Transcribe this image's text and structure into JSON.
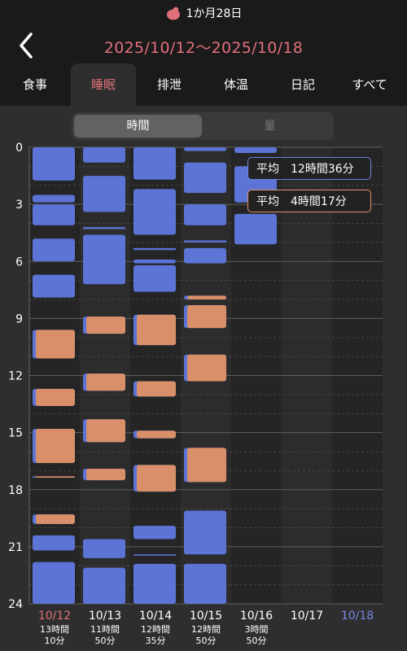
{
  "header": {
    "age": "1か月28日",
    "date_range": "2025/10/12〜2025/10/18"
  },
  "tabs": [
    {
      "label": "食事",
      "active": false
    },
    {
      "label": "睡眠",
      "active": true
    },
    {
      "label": "排泄",
      "active": false
    },
    {
      "label": "体温",
      "active": false
    },
    {
      "label": "日記",
      "active": false
    },
    {
      "label": "すべて",
      "active": false
    }
  ],
  "segment": {
    "selected": "時間",
    "other": "量"
  },
  "averages": [
    {
      "label": "平均",
      "value": "12時間36分"
    },
    {
      "label": "平均",
      "value": "4時間17分"
    }
  ],
  "colors": {
    "sleep": "#5b74d6",
    "sleep_edge": "#6b84e6",
    "overlap": "#d9906a",
    "accent": "#e0707a",
    "saturday": "#7b86e6",
    "panel": "#2e2e2e"
  },
  "chart_data": {
    "type": "bar",
    "ylim": [
      0,
      24
    ],
    "yticks": [
      0,
      3,
      6,
      9,
      12,
      15,
      18,
      21,
      24
    ],
    "categories": [
      "10/12",
      "10/13",
      "10/14",
      "10/15",
      "10/16",
      "10/17",
      "10/18"
    ],
    "totals": [
      [
        "13時間",
        "10分"
      ],
      [
        "11時間",
        "50分"
      ],
      [
        "12時間",
        "35分"
      ],
      [
        "12時間",
        "50分"
      ],
      [
        "3時間",
        "50分"
      ],
      [
        "",
        ""
      ],
      [
        "",
        ""
      ]
    ],
    "series": [
      {
        "values": [
          [
            [
              0,
              1.75
            ],
            [
              2.5,
              2.9
            ],
            [
              3.0,
              4.1
            ],
            [
              4.8,
              6.0
            ],
            [
              6.7,
              7.9
            ],
            [
              9.6,
              11.1
            ],
            [
              12.7,
              13.6
            ],
            [
              14.8,
              16.6
            ],
            [
              17.3,
              17.35
            ],
            [
              19.3,
              19.8
            ],
            [
              20.4,
              21.2
            ],
            [
              21.8,
              24
            ]
          ],
          [
            [
              0,
              0.8
            ],
            [
              1.5,
              3.4
            ],
            [
              4.2,
              4.3
            ],
            [
              4.6,
              7.2
            ],
            [
              8.9,
              9.8
            ],
            [
              11.9,
              12.8
            ],
            [
              14.3,
              15.5
            ],
            [
              16.9,
              17.5
            ],
            [
              20.6,
              21.6
            ],
            [
              22.1,
              24
            ]
          ],
          [
            [
              0,
              1.7
            ],
            [
              2.2,
              4.6
            ],
            [
              5.3,
              5.4
            ],
            [
              5.9,
              6.1
            ],
            [
              6.2,
              7.6
            ],
            [
              8.8,
              10.4
            ],
            [
              12.3,
              13.1
            ],
            [
              14.9,
              15.3
            ],
            [
              16.7,
              18.1
            ],
            [
              19.9,
              20.6
            ],
            [
              21.4,
              21.45
            ],
            [
              21.9,
              24
            ]
          ],
          [
            [
              0,
              0.2
            ],
            [
              0.8,
              2.4
            ],
            [
              3.0,
              4.1
            ],
            [
              4.9,
              5.0
            ],
            [
              5.3,
              6.1
            ],
            [
              7.8,
              8.0
            ],
            [
              8.3,
              9.5
            ],
            [
              10.9,
              12.3
            ],
            [
              15.8,
              17.6
            ],
            [
              19.1,
              21.4
            ],
            [
              21.9,
              24
            ]
          ],
          [
            [
              0,
              0.3
            ],
            [
              1.0,
              2.9
            ],
            [
              3.5,
              5.1
            ]
          ],
          [],
          []
        ]
      },
      {
        "values": [
          [
            [
              9.6,
              11.1
            ],
            [
              12.7,
              13.6
            ],
            [
              14.8,
              16.6
            ],
            [
              17.3,
              17.35
            ],
            [
              19.3,
              19.8
            ]
          ],
          [
            [
              8.9,
              9.8
            ],
            [
              11.9,
              12.8
            ],
            [
              14.3,
              15.5
            ],
            [
              16.9,
              17.5
            ]
          ],
          [
            [
              8.8,
              10.4
            ],
            [
              12.3,
              13.1
            ],
            [
              14.9,
              15.3
            ],
            [
              16.7,
              18.1
            ]
          ],
          [
            [
              7.8,
              8.0
            ],
            [
              8.3,
              9.5
            ],
            [
              10.9,
              12.3
            ],
            [
              15.8,
              17.6
            ]
          ],
          [],
          [],
          []
        ]
      }
    ]
  }
}
